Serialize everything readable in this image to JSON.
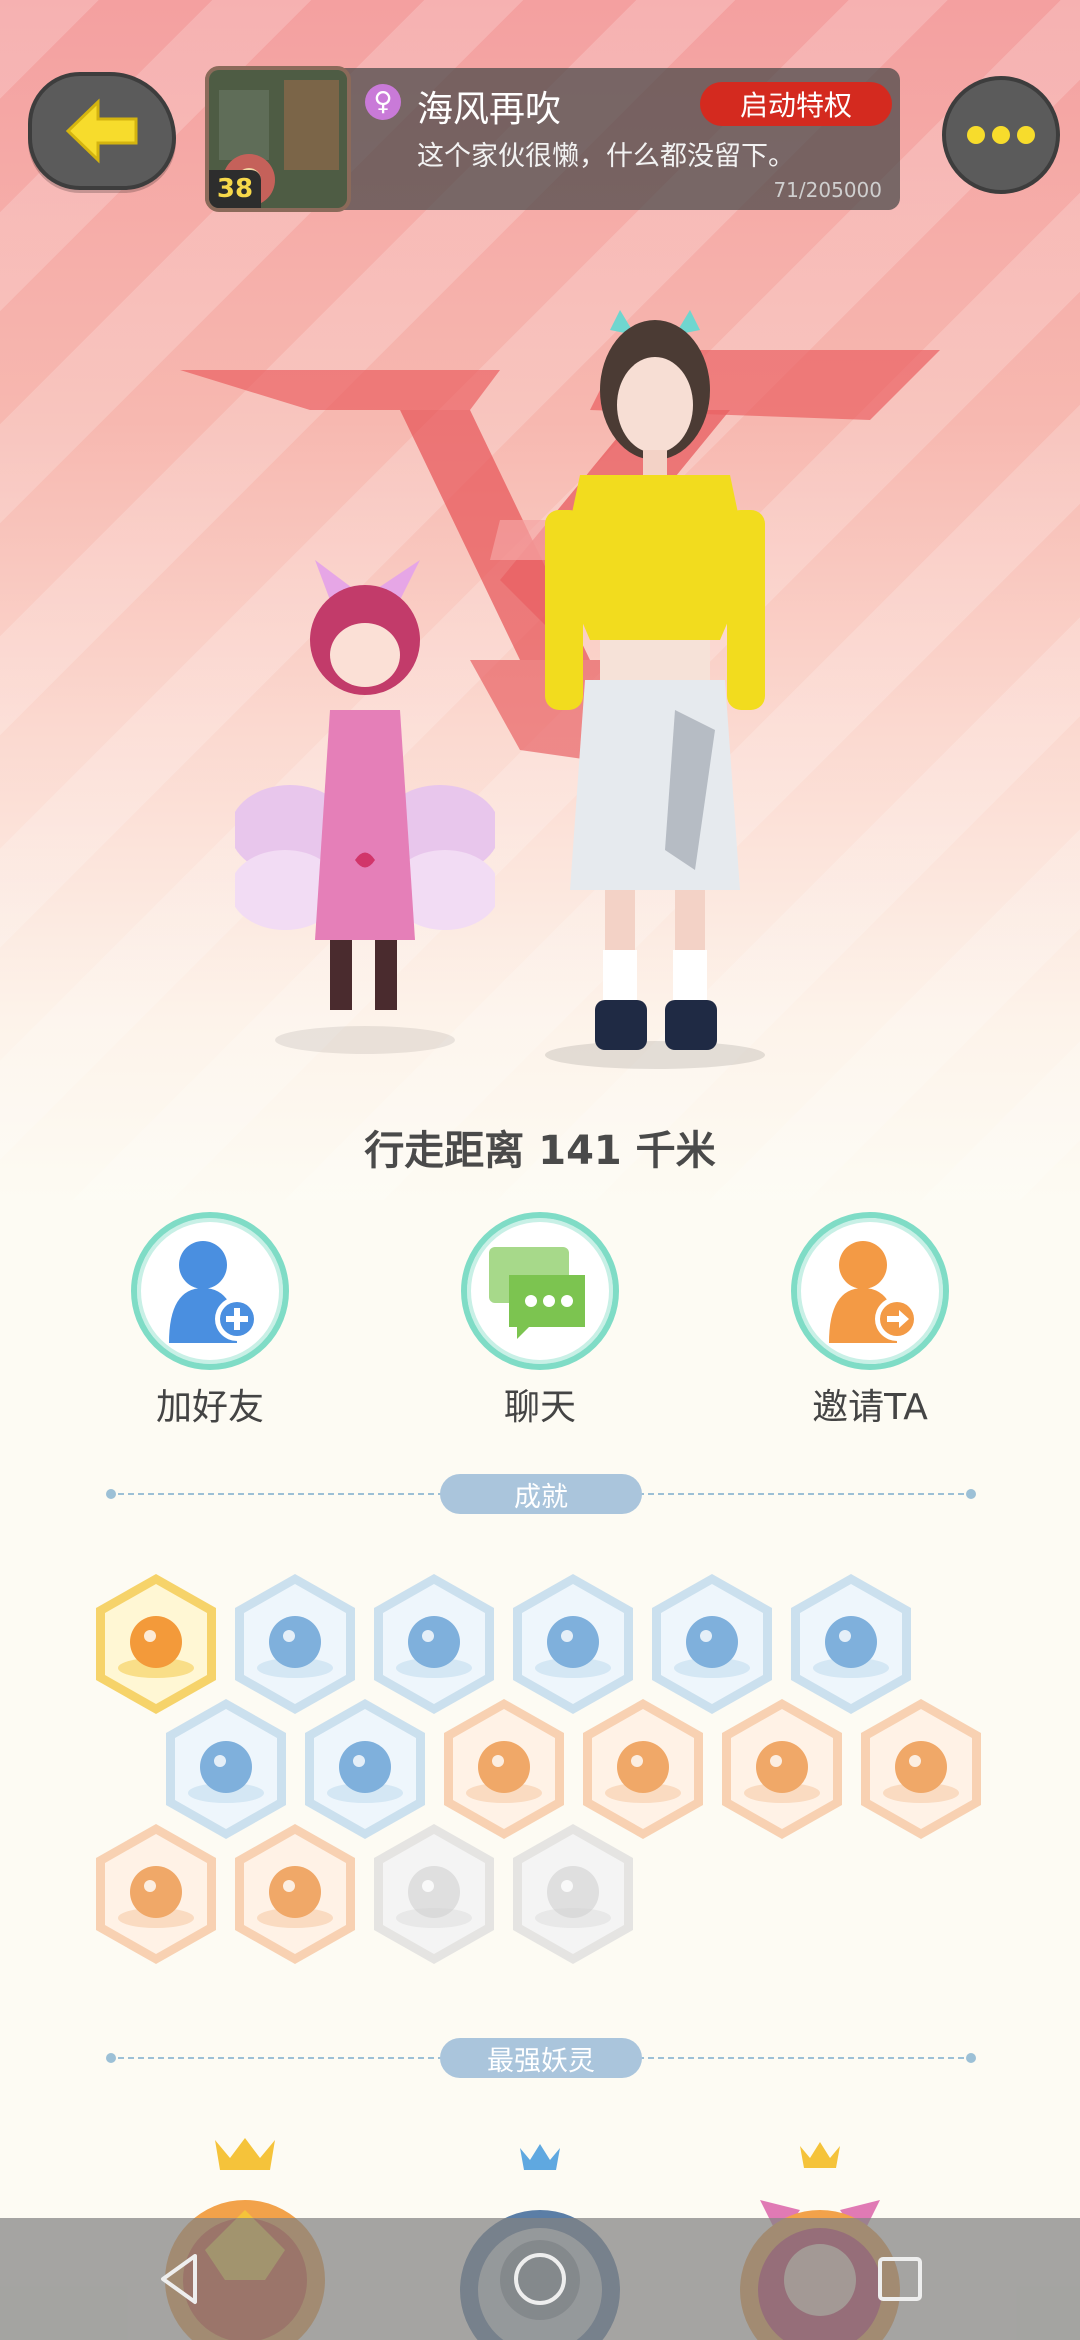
{
  "header": {
    "nickname": "海风再吹",
    "gender_icon": "female-icon",
    "privilege_button": "启动特权",
    "signature": "这个家伙很懒，什么都没留下。",
    "level": "38",
    "exp": "71/205000"
  },
  "stats": {
    "walking_distance": "行走距离 141 千米"
  },
  "actions": [
    {
      "label": "加好友",
      "icon": "add-friend-icon",
      "color": "#4a8fe0"
    },
    {
      "label": "聊天",
      "icon": "chat-icon",
      "color": "#7cc450"
    },
    {
      "label": "邀请TA",
      "icon": "invite-icon",
      "color": "#f39a45"
    }
  ],
  "sections": {
    "achievements": "成就",
    "strongest_spirits": "最强妖灵"
  },
  "achievements": [
    {
      "name": "cat-badge-icon",
      "tone": "gold",
      "unlocked": true
    },
    {
      "name": "sneaker-badge-icon",
      "tone": "blue",
      "unlocked": true
    },
    {
      "name": "compass-badge-icon",
      "tone": "blue",
      "unlocked": true
    },
    {
      "name": "orb-badge-icon",
      "tone": "blue",
      "unlocked": true
    },
    {
      "name": "yin-yang-swirl-badge-icon",
      "tone": "blue",
      "unlocked": true
    },
    {
      "name": "spirit-badge-icon",
      "tone": "blue",
      "unlocked": true
    },
    {
      "name": "fox-badge-icon",
      "tone": "blue",
      "unlocked": true
    },
    {
      "name": "taiji-box-badge-icon",
      "tone": "blue",
      "unlocked": true
    },
    {
      "name": "moon-badge-icon",
      "tone": "orange",
      "unlocked": true
    },
    {
      "name": "crystal-badge-icon",
      "tone": "orange",
      "unlocked": true
    },
    {
      "name": "cart-badge-icon",
      "tone": "orange",
      "unlocked": true
    },
    {
      "name": "scroll-badge-icon",
      "tone": "orange",
      "unlocked": true
    },
    {
      "name": "dragon-badge-icon",
      "tone": "orange",
      "unlocked": true
    },
    {
      "name": "beast-badge-icon",
      "tone": "orange",
      "unlocked": true
    },
    {
      "name": "warrior-badge-icon",
      "tone": "gray",
      "unlocked": false
    },
    {
      "name": "wolf-badge-icon",
      "tone": "gray",
      "unlocked": false
    }
  ],
  "colors": {
    "gold": "#f3c53c",
    "blue": "#b9d7ec",
    "orange": "#f6c39c",
    "gray": "#dcdcdc",
    "accent_red": "#d42a1f",
    "action_ring": "#7fdcc6"
  },
  "navbar": [
    "back-nav-icon",
    "home-nav-icon",
    "recents-nav-icon"
  ]
}
